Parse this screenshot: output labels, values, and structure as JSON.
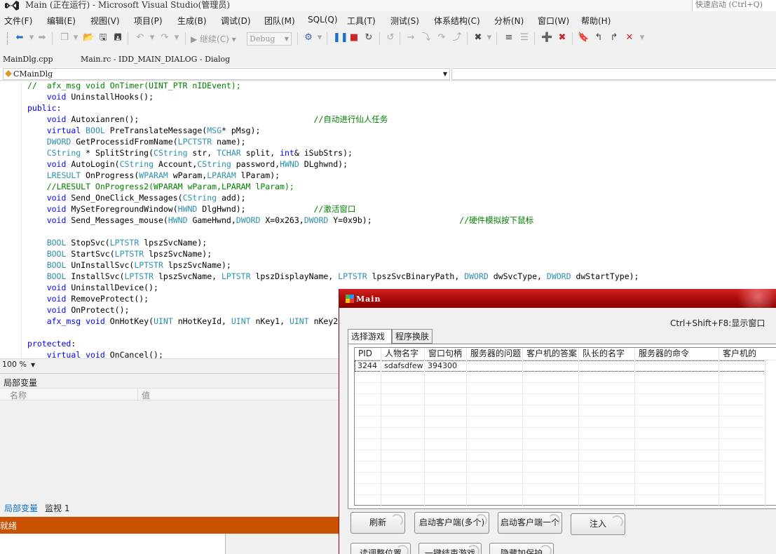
{
  "window": {
    "title": "Main (正在运行) - Microsoft Visual Studio(管理员)",
    "quick_launch": "快速启动 (Ctrl+Q)"
  },
  "menu": [
    "文件(F)",
    "编辑(E)",
    "视图(V)",
    "项目(P)",
    "生成(B)",
    "调试(D)",
    "团队(M)",
    "SQL(Q)",
    "工具(T)",
    "测试(S)",
    "体系结构(C)",
    "分析(N)",
    "窗口(W)",
    "帮助(H)"
  ],
  "toolbar": {
    "continue_label": "继续(C)",
    "config_value": "Debug"
  },
  "doc_tabs": [
    "MainDlg.cpp",
    "Main.rc - IDD_MAIN_DIALOG - Dialog"
  ],
  "navbar": {
    "class_name": "CMainDlg"
  },
  "editor": {
    "zoom": "100 %",
    "lines": [
      [
        {
          "t": "//  afx_msg void OnTimer(UINT_PTR nIDEvent);",
          "c": "cm"
        }
      ],
      [
        {
          "t": "    ",
          "c": "tx"
        },
        {
          "t": "void",
          "c": "kw"
        },
        {
          "t": " UninstallHooks();",
          "c": "tx"
        }
      ],
      [
        {
          "t": "public",
          "c": "kw"
        },
        {
          "t": ":",
          "c": "tx"
        }
      ],
      [
        {
          "t": "    ",
          "c": "tx"
        },
        {
          "t": "void",
          "c": "kw"
        },
        {
          "t": " Autoxianren();                                    ",
          "c": "tx"
        },
        {
          "t": "//自动进行仙人任务",
          "c": "cm"
        }
      ],
      [
        {
          "t": "    ",
          "c": "tx"
        },
        {
          "t": "virtual",
          "c": "kw"
        },
        {
          "t": " ",
          "c": "tx"
        },
        {
          "t": "BOOL",
          "c": "ty"
        },
        {
          "t": " PreTranslateMessage(",
          "c": "tx"
        },
        {
          "t": "MSG",
          "c": "ty"
        },
        {
          "t": "* pMsg);",
          "c": "tx"
        }
      ],
      [
        {
          "t": "    ",
          "c": "tx"
        },
        {
          "t": "DWORD",
          "c": "ty"
        },
        {
          "t": " GetProcessidFromName(",
          "c": "tx"
        },
        {
          "t": "LPCTSTR",
          "c": "ty"
        },
        {
          "t": " name);",
          "c": "tx"
        }
      ],
      [
        {
          "t": "    ",
          "c": "tx"
        },
        {
          "t": "CString",
          "c": "ty"
        },
        {
          "t": " * SplitString(",
          "c": "tx"
        },
        {
          "t": "CString",
          "c": "ty"
        },
        {
          "t": " str, ",
          "c": "tx"
        },
        {
          "t": "TCHAR",
          "c": "ty"
        },
        {
          "t": " split, ",
          "c": "tx"
        },
        {
          "t": "int",
          "c": "kw"
        },
        {
          "t": "& iSubStrs);",
          "c": "tx"
        }
      ],
      [
        {
          "t": "    ",
          "c": "tx"
        },
        {
          "t": "void",
          "c": "kw"
        },
        {
          "t": " AutoLogin(",
          "c": "tx"
        },
        {
          "t": "CString",
          "c": "ty"
        },
        {
          "t": " Account,",
          "c": "tx"
        },
        {
          "t": "CString",
          "c": "ty"
        },
        {
          "t": " password,",
          "c": "tx"
        },
        {
          "t": "HWND",
          "c": "ty"
        },
        {
          "t": " DLghwnd);",
          "c": "tx"
        }
      ],
      [
        {
          "t": "    ",
          "c": "tx"
        },
        {
          "t": "LRESULT",
          "c": "ty"
        },
        {
          "t": " OnProgress(",
          "c": "tx"
        },
        {
          "t": "WPARAM",
          "c": "ty"
        },
        {
          "t": " wParam,",
          "c": "tx"
        },
        {
          "t": "LPARAM",
          "c": "ty"
        },
        {
          "t": " lParam);",
          "c": "tx"
        }
      ],
      [
        {
          "t": "    //LRESULT OnProgress2(WPARAM wParam,LPARAM lParam);",
          "c": "cm"
        }
      ],
      [
        {
          "t": "    ",
          "c": "tx"
        },
        {
          "t": "void",
          "c": "kw"
        },
        {
          "t": " Send_OneClick_Messages(",
          "c": "tx"
        },
        {
          "t": "CString",
          "c": "ty"
        },
        {
          "t": " add);",
          "c": "tx"
        }
      ],
      [
        {
          "t": "    ",
          "c": "tx"
        },
        {
          "t": "void",
          "c": "kw"
        },
        {
          "t": " MySetForegroundWindow(",
          "c": "tx"
        },
        {
          "t": "HWND",
          "c": "ty"
        },
        {
          "t": " DlgHwnd);              ",
          "c": "tx"
        },
        {
          "t": "//激活窗口",
          "c": "cm"
        }
      ],
      [
        {
          "t": "    ",
          "c": "tx"
        },
        {
          "t": "void",
          "c": "kw"
        },
        {
          "t": " Send_Messages_mouse(",
          "c": "tx"
        },
        {
          "t": "HWND",
          "c": "ty"
        },
        {
          "t": " GameHwnd,",
          "c": "tx"
        },
        {
          "t": "DWORD",
          "c": "ty"
        },
        {
          "t": " X=0x263,",
          "c": "tx"
        },
        {
          "t": "DWORD",
          "c": "ty"
        },
        {
          "t": " Y=0x9b);                  ",
          "c": "tx"
        },
        {
          "t": "//硬件模拟按下鼠标",
          "c": "cm"
        }
      ],
      [
        {
          "t": " ",
          "c": "tx"
        }
      ],
      [
        {
          "t": "    ",
          "c": "tx"
        },
        {
          "t": "BOOL",
          "c": "ty"
        },
        {
          "t": " StopSvc(",
          "c": "tx"
        },
        {
          "t": "LPTSTR",
          "c": "ty"
        },
        {
          "t": " lpszSvcName);",
          "c": "tx"
        }
      ],
      [
        {
          "t": "    ",
          "c": "tx"
        },
        {
          "t": "BOOL",
          "c": "ty"
        },
        {
          "t": " StartSvc(",
          "c": "tx"
        },
        {
          "t": "LPTSTR",
          "c": "ty"
        },
        {
          "t": " lpszSvcName);",
          "c": "tx"
        }
      ],
      [
        {
          "t": "    ",
          "c": "tx"
        },
        {
          "t": "BOOL",
          "c": "ty"
        },
        {
          "t": " UnInstallSvc(",
          "c": "tx"
        },
        {
          "t": "LPTSTR",
          "c": "ty"
        },
        {
          "t": " lpszSvcName);",
          "c": "tx"
        }
      ],
      [
        {
          "t": "    ",
          "c": "tx"
        },
        {
          "t": "BOOL",
          "c": "ty"
        },
        {
          "t": " InstallSvc(",
          "c": "tx"
        },
        {
          "t": "LPTSTR",
          "c": "ty"
        },
        {
          "t": " lpszSvcName, ",
          "c": "tx"
        },
        {
          "t": "LPTSTR",
          "c": "ty"
        },
        {
          "t": " lpszDisplayName, ",
          "c": "tx"
        },
        {
          "t": "LPTSTR",
          "c": "ty"
        },
        {
          "t": " lpszSvcBinaryPath, ",
          "c": "tx"
        },
        {
          "t": "DWORD",
          "c": "ty"
        },
        {
          "t": " dwSvcType, ",
          "c": "tx"
        },
        {
          "t": "DWORD",
          "c": "ty"
        },
        {
          "t": " dwStartType);",
          "c": "tx"
        }
      ],
      [
        {
          "t": "    ",
          "c": "tx"
        },
        {
          "t": "void",
          "c": "kw"
        },
        {
          "t": " UninstallDevice();",
          "c": "tx"
        }
      ],
      [
        {
          "t": "    ",
          "c": "tx"
        },
        {
          "t": "void",
          "c": "kw"
        },
        {
          "t": " RemoveProtect();",
          "c": "tx"
        }
      ],
      [
        {
          "t": "    ",
          "c": "tx"
        },
        {
          "t": "void",
          "c": "kw"
        },
        {
          "t": " OnProtect();",
          "c": "tx"
        }
      ],
      [
        {
          "t": "    ",
          "c": "tx"
        },
        {
          "t": "afx_msg",
          "c": "kw"
        },
        {
          "t": " ",
          "c": "tx"
        },
        {
          "t": "void",
          "c": "kw"
        },
        {
          "t": " OnHotKey(",
          "c": "tx"
        },
        {
          "t": "UINT",
          "c": "ty"
        },
        {
          "t": " nHotKeyId, ",
          "c": "tx"
        },
        {
          "t": "UINT",
          "c": "ty"
        },
        {
          "t": " nKey1, ",
          "c": "tx"
        },
        {
          "t": "UINT",
          "c": "ty"
        },
        {
          "t": " nKey2",
          "c": "tx"
        }
      ],
      [
        {
          "t": " ",
          "c": "tx"
        }
      ],
      [
        {
          "t": "protected",
          "c": "kw"
        },
        {
          "t": ":",
          "c": "tx"
        }
      ],
      [
        {
          "t": "    ",
          "c": "tx"
        },
        {
          "t": "virtual",
          "c": "kw"
        },
        {
          "t": " ",
          "c": "tx"
        },
        {
          "t": "void",
          "c": "kw"
        },
        {
          "t": " OnCancel();",
          "c": "tx"
        }
      ]
    ]
  },
  "locals": {
    "title": "局部变量",
    "col_name": "名称",
    "col_value": "值",
    "tab_locals": "局部变量",
    "tab_watch": "监视 1"
  },
  "status": {
    "text": "就绪"
  },
  "dialog": {
    "title": "Main",
    "hint": "Ctrl+Shift+F8:显示窗口",
    "tabs": [
      "选择游戏",
      "程序换肤"
    ],
    "columns": [
      "PID",
      "人物名字",
      "窗口句柄",
      "服务器的问题",
      "客户机的答案",
      "队长的名字",
      "服务器的命令",
      "客户机的"
    ],
    "rows": [
      [
        "3244",
        "sdafsdfew",
        "394300",
        "",
        "",
        "",
        "",
        ""
      ]
    ],
    "buttons_row1": [
      "刷新",
      "启动客户端(多个)",
      "启动客户端一个",
      "注入"
    ],
    "buttons_row2": [
      "读调整位置",
      "一键结束游戏",
      "隐藏加保护"
    ]
  }
}
